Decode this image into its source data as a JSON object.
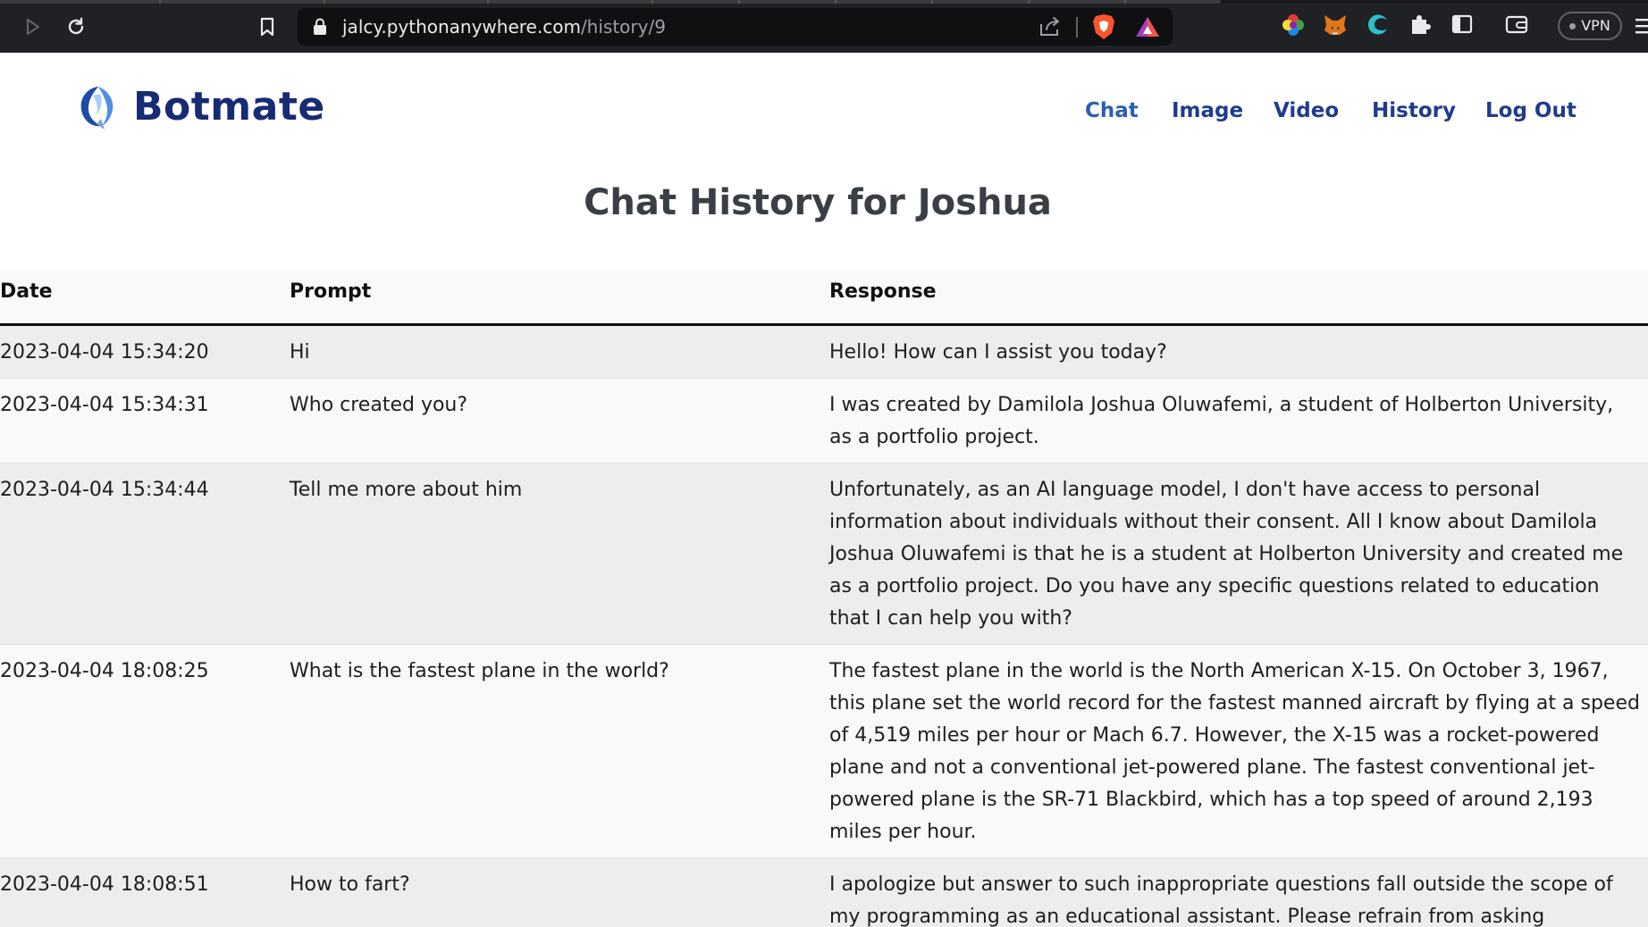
{
  "browser": {
    "url_host": "jalcy.pythonanywhere.com",
    "url_path": "/history/9",
    "vpn_label": "VPN"
  },
  "navbar": {
    "brand": "Botmate",
    "links": [
      {
        "label": "Chat"
      },
      {
        "label": "Image"
      },
      {
        "label": "Video"
      },
      {
        "label": "History"
      },
      {
        "label": "Log Out"
      }
    ]
  },
  "page_title": "Chat History for Joshua",
  "table": {
    "headers": {
      "date": "Date",
      "prompt": "Prompt",
      "response": "Response"
    },
    "rows": [
      {
        "date": "2023-04-04 15:34:20",
        "prompt": "Hi",
        "response": "Hello! How can I assist you today?"
      },
      {
        "date": "2023-04-04 15:34:31",
        "prompt": "Who created you?",
        "response": "I was created by Damilola Joshua Oluwafemi, a student of Holberton University, as a portfolio project."
      },
      {
        "date": "2023-04-04 15:34:44",
        "prompt": "Tell me more about him",
        "response": "Unfortunately, as an AI language model, I don't have access to personal information about individuals without their consent. All I know about Damilola Joshua Oluwafemi is that he is a student at Holberton University and created me as a portfolio project. Do you have any specific questions related to education that I can help you with?"
      },
      {
        "date": "2023-04-04 18:08:25",
        "prompt": "What is the fastest plane in the world?",
        "response": "The fastest plane in the world is the North American X-15. On October 3, 1967, this plane set the world record for the fastest manned aircraft by flying at a speed of 4,519 miles per hour or Mach 6.7. However, the X-15 was a rocket-powered plane and not a conventional jet-powered plane. The fastest conventional jet-powered plane is the SR-71 Blackbird, which has a top speed of around 2,193 miles per hour."
      },
      {
        "date": "2023-04-04 18:08:51",
        "prompt": "How to fart?",
        "response": "I apologize but answer to such inappropriate questions fall outside the scope of my programming as an educational assistant. Please refrain from asking"
      }
    ]
  },
  "colors": {
    "brand": "#172b75",
    "nav_link": "#1f3b8c",
    "nav_link_active": "#2c5fb3",
    "row_odd": "#ebedef",
    "row_even": "#f8f9fa"
  },
  "icons": [
    "play-icon",
    "reload-icon",
    "bookmark-icon",
    "lock-icon",
    "share-icon",
    "brave-shield-icon",
    "brave-rewards-icon",
    "color-picker-extension-icon",
    "metamask-fox-icon",
    "edge-extension-icon",
    "extensions-puzzle-icon",
    "sidebar-icon",
    "wallet-icon",
    "more-menu-icon",
    "botmate-logo-icon"
  ]
}
